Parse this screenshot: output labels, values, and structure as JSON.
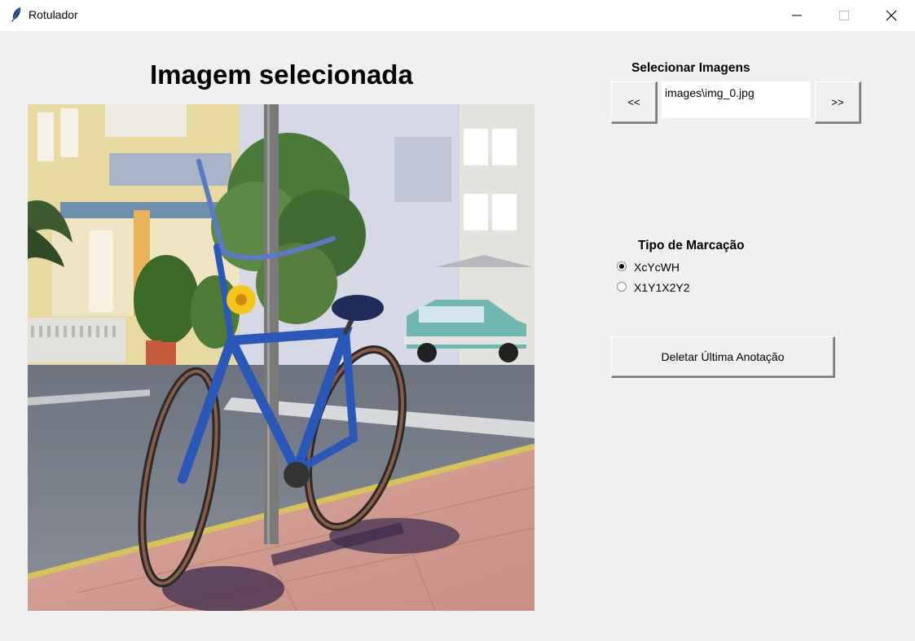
{
  "window": {
    "title": "Rotulador",
    "icon": "feather-icon"
  },
  "main": {
    "heading": "Imagem selecionada"
  },
  "image_selector": {
    "label": "Selecionar Imagens",
    "prev_label": "<<",
    "next_label": ">>",
    "current_path": "images\\img_0.jpg"
  },
  "annotation_type": {
    "label": "Tipo de Marcação",
    "options": [
      {
        "label": "XcYcWH",
        "selected": true
      },
      {
        "label": "X1Y1X2Y2",
        "selected": false
      }
    ]
  },
  "actions": {
    "delete_last_label": "Deletar Última Anotação"
  }
}
